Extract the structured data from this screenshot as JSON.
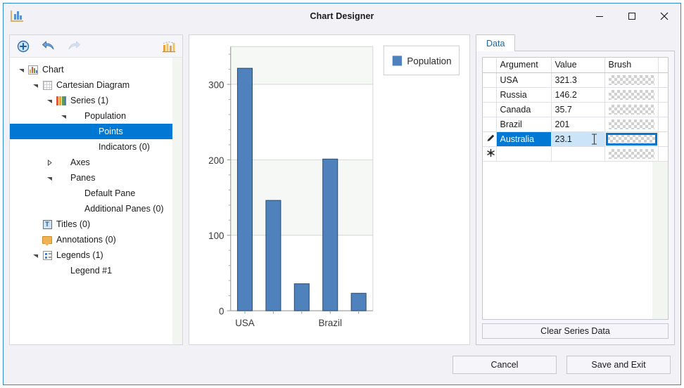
{
  "window": {
    "title": "Chart Designer",
    "app_icon": "chart-icon",
    "controls": [
      {
        "name": "minimize",
        "glyph": "minimize-icon"
      },
      {
        "name": "maximize",
        "glyph": "maximize-icon"
      },
      {
        "name": "close",
        "glyph": "close-icon"
      }
    ]
  },
  "toolbar": {
    "buttons": [
      {
        "name": "add-element-button",
        "icon": "plus-circle-icon",
        "enabled": true
      },
      {
        "name": "undo-button",
        "icon": "undo-arrow-icon",
        "enabled": true
      },
      {
        "name": "redo-button",
        "icon": "redo-arrow-icon",
        "enabled": false
      },
      {
        "name": "chart-wizard-button",
        "icon": "chart-wizard-icon",
        "enabled": true
      }
    ]
  },
  "tree": {
    "nodes": [
      {
        "label": "Chart",
        "depth": 0,
        "expander": "expanded",
        "icon": "chart-icon",
        "selected": false
      },
      {
        "label": "Cartesian Diagram",
        "depth": 1,
        "expander": "expanded",
        "icon": "grid-icon",
        "selected": false
      },
      {
        "label": "Series (1)",
        "depth": 2,
        "expander": "expanded",
        "icon": "series-bars-icon",
        "selected": false
      },
      {
        "label": "Population",
        "depth": 3,
        "expander": "expanded",
        "icon": "none",
        "selected": false
      },
      {
        "label": "Points",
        "depth": 4,
        "expander": "none",
        "icon": "none",
        "selected": true
      },
      {
        "label": "Indicators (0)",
        "depth": 4,
        "expander": "none",
        "icon": "none",
        "selected": false
      },
      {
        "label": "Axes",
        "depth": 2,
        "expander": "collapsed",
        "icon": "none",
        "selected": false
      },
      {
        "label": "Panes",
        "depth": 2,
        "expander": "expanded",
        "icon": "none",
        "selected": false
      },
      {
        "label": "Default Pane",
        "depth": 3,
        "expander": "none",
        "icon": "none",
        "selected": false
      },
      {
        "label": "Additional Panes (0)",
        "depth": 3,
        "expander": "none",
        "icon": "none",
        "selected": false
      },
      {
        "label": "Titles (0)",
        "depth": 1,
        "expander": "none",
        "icon": "title-icon",
        "selected": false
      },
      {
        "label": "Annotations (0)",
        "depth": 1,
        "expander": "none",
        "icon": "annotation-icon",
        "selected": false
      },
      {
        "label": "Legends (1)",
        "depth": 1,
        "expander": "expanded",
        "icon": "legend-icon",
        "selected": false
      },
      {
        "label": "Legend #1",
        "depth": 2,
        "expander": "none",
        "icon": "none",
        "selected": false
      }
    ]
  },
  "chart_data": {
    "type": "bar",
    "title": "",
    "xlabel": "",
    "ylabel": "",
    "categories": [
      "USA",
      "Russia",
      "Canada",
      "Brazil",
      "Australia"
    ],
    "visible_tick_labels": [
      "USA",
      "Brazil"
    ],
    "values": [
      321.3,
      146.2,
      35.7,
      201,
      23.1
    ],
    "series": [
      {
        "name": "Population",
        "values": [
          321.3,
          146.2,
          35.7,
          201,
          23.1
        ],
        "color": "#4f81bd"
      }
    ],
    "ylim": [
      0,
      350
    ],
    "yticks": [
      0,
      100,
      200,
      300
    ],
    "ytick_labels": [
      "0",
      "100",
      "200",
      "300"
    ],
    "grid": true,
    "legend": {
      "position": "top-right",
      "entries": [
        "Population"
      ]
    },
    "bar_color": "#4f81bd",
    "bar_border_color": "#2d4f73"
  },
  "data_panel": {
    "tab_label": "Data",
    "columns": [
      "Argument",
      "Value",
      "Brush"
    ],
    "rows": [
      {
        "row_marker": "",
        "argument": "USA",
        "value": "321.3",
        "brush": "transparent",
        "selected": false
      },
      {
        "row_marker": "",
        "argument": "Russia",
        "value": "146.2",
        "brush": "transparent",
        "selected": false
      },
      {
        "row_marker": "",
        "argument": "Canada",
        "value": "35.7",
        "brush": "transparent",
        "selected": false
      },
      {
        "row_marker": "",
        "argument": "Brazil",
        "value": "201",
        "brush": "transparent",
        "selected": false
      },
      {
        "row_marker": "pencil-edit-icon",
        "argument": "Australia",
        "value": "23.1",
        "brush": "transparent",
        "selected": true
      },
      {
        "row_marker": "asterisk-new-row-icon",
        "argument": "",
        "value": "",
        "brush": "transparent",
        "selected": false
      }
    ],
    "clear_button_label": "Clear Series Data"
  },
  "footer": {
    "cancel_label": "Cancel",
    "save_label": "Save and Exit"
  },
  "colors": {
    "accent": "#0078d4",
    "window_border": "#2e8bd0",
    "bar": "#4f81bd",
    "tab_text": "#1667b3"
  }
}
